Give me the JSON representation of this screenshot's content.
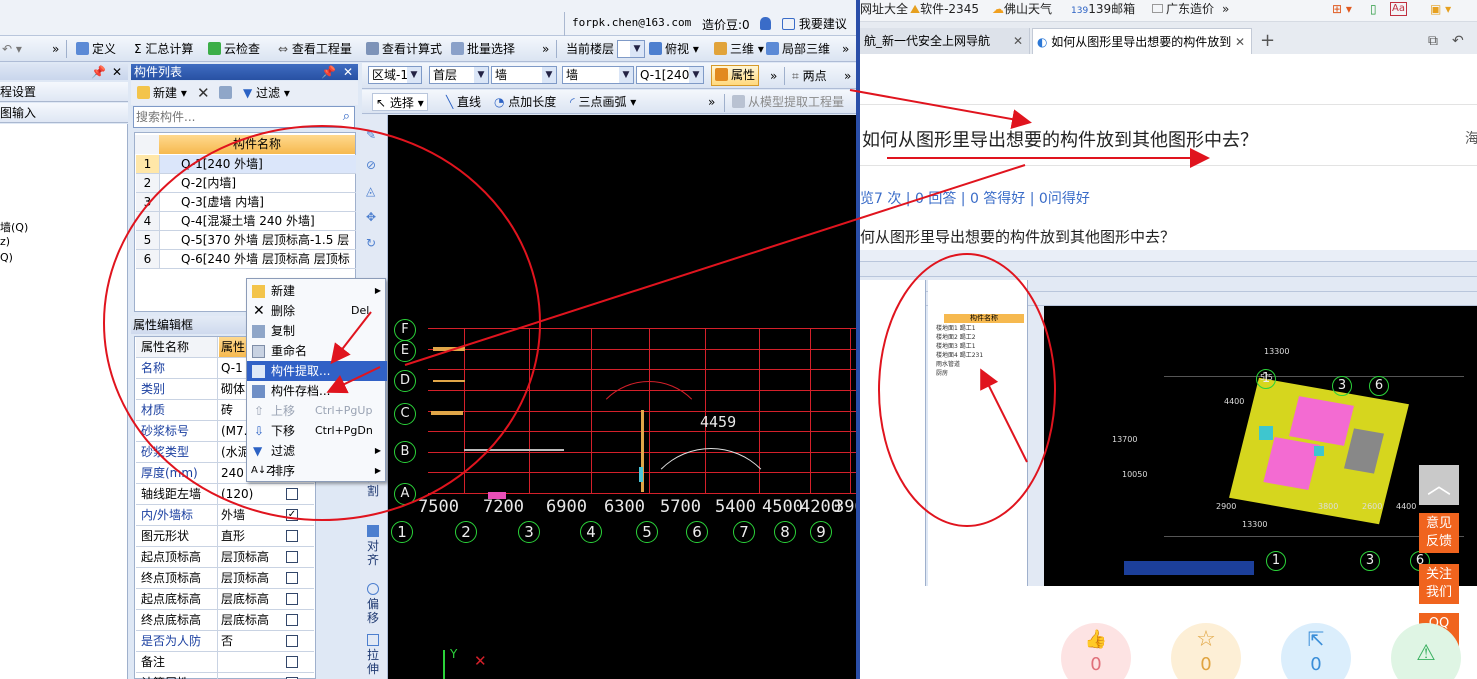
{
  "app": {
    "user_email": "forpk.chen@163.com",
    "zaojiadou_label": "造价豆:0",
    "suggest_label": "我要建议",
    "toolbar1": {
      "define": "定义",
      "summary_calc": "汇总计算",
      "cloud_check": "云检查",
      "view_quantity": "查看工程量",
      "view_formula": "查看计算式",
      "batch_select": "批量选择",
      "current_floor": "当前楼层",
      "top_view": "俯视",
      "three_d": "三维",
      "local_3d": "局部三维"
    },
    "toolbar2": {
      "region": "区域-1",
      "floor": "首层",
      "category": "墙",
      "type": "墙",
      "component": "Q-1[240 :",
      "properties": "属性",
      "two_points": "两点"
    },
    "toolbar3": {
      "select": "选择",
      "line": "直线",
      "point_length": "点加长度",
      "three_point_arc": "三点画弧",
      "extract_from_model": "从模型提取工程量"
    },
    "left_nav": {
      "project_settings": "程设置",
      "drawing_input": "图输入",
      "tree_items": [
        "墙(Q)",
        "z)",
        "Q)"
      ]
    },
    "component_list": {
      "title": "构件列表",
      "new": "新建",
      "filter": "过滤",
      "search_placeholder": "搜索构件...",
      "column_header": "构件名称",
      "rows": [
        {
          "num": "1",
          "name": "Q-1[240 外墙]"
        },
        {
          "num": "2",
          "name": "Q-2[内墙]"
        },
        {
          "num": "3",
          "name": "Q-3[虚墙 内墙]"
        },
        {
          "num": "4",
          "name": "Q-4[混凝土墙 240 外墙]"
        },
        {
          "num": "5",
          "name": "Q-5[370 外墙 层顶标高-1.5 层"
        },
        {
          "num": "6",
          "name": "Q-6[240 外墙 层顶标高 层顶标"
        }
      ]
    },
    "property_editor": {
      "title": "属性编辑框",
      "col_name": "属性名称",
      "col_value": "属性",
      "rows": [
        {
          "name": "名称",
          "value": "Q-1",
          "checked": false,
          "blue": true
        },
        {
          "name": "类别",
          "value": "砌体",
          "checked": false,
          "blue": true
        },
        {
          "name": "材质",
          "value": "砖",
          "checked": false,
          "blue": true
        },
        {
          "name": "砂浆标号",
          "value": "(M7.",
          "checked": false,
          "blue": true
        },
        {
          "name": "砂浆类型",
          "value": "(水泥",
          "checked": false,
          "blue": true
        },
        {
          "name": "厚度(mm)",
          "value": "240",
          "checked": false,
          "blue": true
        },
        {
          "name": "轴线距左墙",
          "value": "(120)",
          "checked": false,
          "blue": false
        },
        {
          "name": "内/外墙标",
          "value": "外墙",
          "checked": true,
          "blue": true
        },
        {
          "name": "图元形状",
          "value": "直形",
          "checked": false,
          "blue": false
        },
        {
          "name": "起点顶标高",
          "value": "层顶标高",
          "checked": false,
          "blue": false
        },
        {
          "name": "终点顶标高",
          "value": "层顶标高",
          "checked": false,
          "blue": false
        },
        {
          "name": "起点底标高",
          "value": "层底标高",
          "checked": false,
          "blue": false
        },
        {
          "name": "终点底标高",
          "value": "层底标高",
          "checked": false,
          "blue": false
        },
        {
          "name": "是否为人防",
          "value": "否",
          "checked": false,
          "blue": true
        },
        {
          "name": "备注",
          "value": "",
          "checked": false,
          "blue": false
        },
        {
          "name": "计算属性",
          "value": "",
          "checked": false,
          "blue": false
        }
      ]
    },
    "context_menu": {
      "new": "新建",
      "delete": "删除",
      "delete_shortcut": "Del",
      "copy": "复制",
      "rename": "重命名",
      "extract": "构件提取...",
      "save": "构件存档...",
      "move_up": "上移",
      "move_up_shortcut": "Ctrl+PgUp",
      "move_down": "下移",
      "move_down_shortcut": "Ctrl+PgDn",
      "filter": "过滤",
      "sort": "排序"
    },
    "vertical_tools": {
      "split": "分割",
      "align": "对齐",
      "offset": "偏移",
      "stretch": "拉伸"
    },
    "canvas": {
      "row_labels": [
        "F",
        "E",
        "D",
        "C",
        "B",
        "A"
      ],
      "column_numbers": [
        "1",
        "2",
        "3",
        "4",
        "5",
        "6",
        "7",
        "8",
        "9"
      ],
      "dimensions": [
        "7500",
        "7200",
        "6900",
        "6300",
        "5700",
        "5400",
        "4500",
        "4200",
        "390"
      ],
      "arc_dimension": "4459",
      "y_axis": "Y"
    }
  },
  "browser": {
    "bookmarks": [
      "网址大全",
      "软件-2345",
      "佛山天气",
      "139邮箱",
      "广东造价"
    ],
    "tabs": [
      {
        "label": "航_新一代安全上网导航"
      },
      {
        "label": "如何从图形里导出想要的构件放到"
      }
    ],
    "question_title": "如何从图形里导出想要的构件放到其他图形中去？",
    "header_right": "海",
    "stats": "览7 次 | 0 回答 | 0 答得好 | 0问得好",
    "question_body": "何从图形里导出想要的构件放到其他图形中去？",
    "side_buttons": {
      "feedback": "意见反馈",
      "follow": "关注我们",
      "qq": "QQ咨询"
    },
    "actions": [
      {
        "name": "like",
        "count": "0"
      },
      {
        "name": "favorite",
        "count": "0"
      },
      {
        "name": "share",
        "count": "0"
      }
    ],
    "embedded": {
      "list_header": "构件名称",
      "rows": [
        "楼地面1 踢工1",
        "楼地面2 踢工2",
        "楼地面3 踢工1",
        "楼地面4 踢工231",
        "雨水管道",
        "厨房"
      ],
      "dims": [
        "13300",
        "4400",
        "5/5",
        "13700",
        "2900",
        "3800",
        "2600",
        "4400",
        "10050",
        "13300"
      ]
    }
  }
}
